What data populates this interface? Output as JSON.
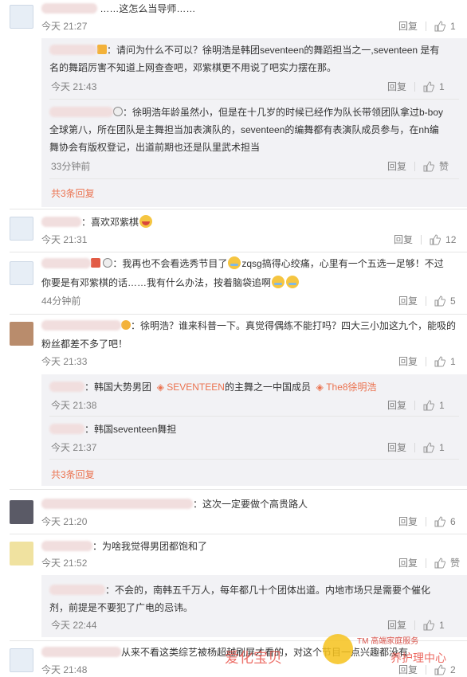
{
  "c1": {
    "text": "……这怎么当导师……",
    "time": "今天 21:27",
    "reply": "回复",
    "likes": "1"
  },
  "r1": {
    "text": "：请问为什么不可以？徐明浩是韩团seventeen的舞蹈担当之一,seventeen 是有",
    "text2": "名的舞蹈厉害不知道上网查查吧，邓紫棋更不用说了吧实力摆在那。",
    "time": "今天 21:43",
    "reply": "回复",
    "likes": "1"
  },
  "r2": {
    "text": "：徐明浩年龄虽然小，但是在十几岁的时候已经作为队长带领团队拿过b-boy",
    "text2": "全球第八，所在团队是主舞担当加表演队的，seventeen的编舞都有表演队成员参与，在nh编",
    "text3": "舞协会有版权登记，出道前期也还是队里武术担当",
    "time": "33分钟前",
    "reply": "回复",
    "likes": "赞"
  },
  "more1": "共3条回复",
  "c2": {
    "text": "：喜欢邓紫棋",
    "time": "今天 21:31",
    "reply": "回复",
    "likes": "12"
  },
  "c3": {
    "text": "：我再也不会看选秀节目了",
    "text_b": "zqsg搞得心绞痛，心里有一个五选一足够！不过",
    "text2": "你要是有邓紫棋的话……我有什么办法，按着脑袋追啊",
    "time": "44分钟前",
    "reply": "回复",
    "likes": "5"
  },
  "c4": {
    "text": "：徐明浩？谁来科普一下。真觉得偶练不能打吗？四大三小加这九个，能吸的",
    "text2": "粉丝都差不多了吧！",
    "time": "今天 21:33",
    "reply": "回复",
    "likes": "1"
  },
  "r3": {
    "prefix": "：韩国大势男团",
    "tag1": "SEVENTEEN",
    "mid": "的主舞之一中国成员",
    "tag2": "The8徐明浩",
    "time": "今天 21:38",
    "reply": "回复",
    "likes": "1"
  },
  "r4": {
    "text": "：韩国seventeen舞担",
    "time": "今天 21:37",
    "reply": "回复",
    "likes": "1"
  },
  "more2": "共3条回复",
  "c5": {
    "text": "：这次一定要做个高贵路人",
    "time": "今天 21:20",
    "reply": "回复",
    "likes": "6"
  },
  "c6": {
    "text": "：为啥我觉得男团都饱和了",
    "time": "今天 21:52",
    "reply": "回复",
    "likes": "赞"
  },
  "r5": {
    "text": "：不会的，南韩五千万人，每年都几十个团体出道。内地市场只是需要个催化",
    "text2": "剂，前提是不要犯了广电的忌讳。",
    "time": "今天 22:44",
    "reply": "回复",
    "likes": "1"
  },
  "c7": {
    "text": "从来不看这类综艺被杨超越刷屏才看的，对这个节目一点兴趣都没有",
    "time": "今天 21:48",
    "reply": "回复",
    "likes": "2"
  },
  "watermark": {
    "left": "爱化宝贝",
    "brand": "TM 高端家庭服务",
    "right": "养护理中心"
  }
}
